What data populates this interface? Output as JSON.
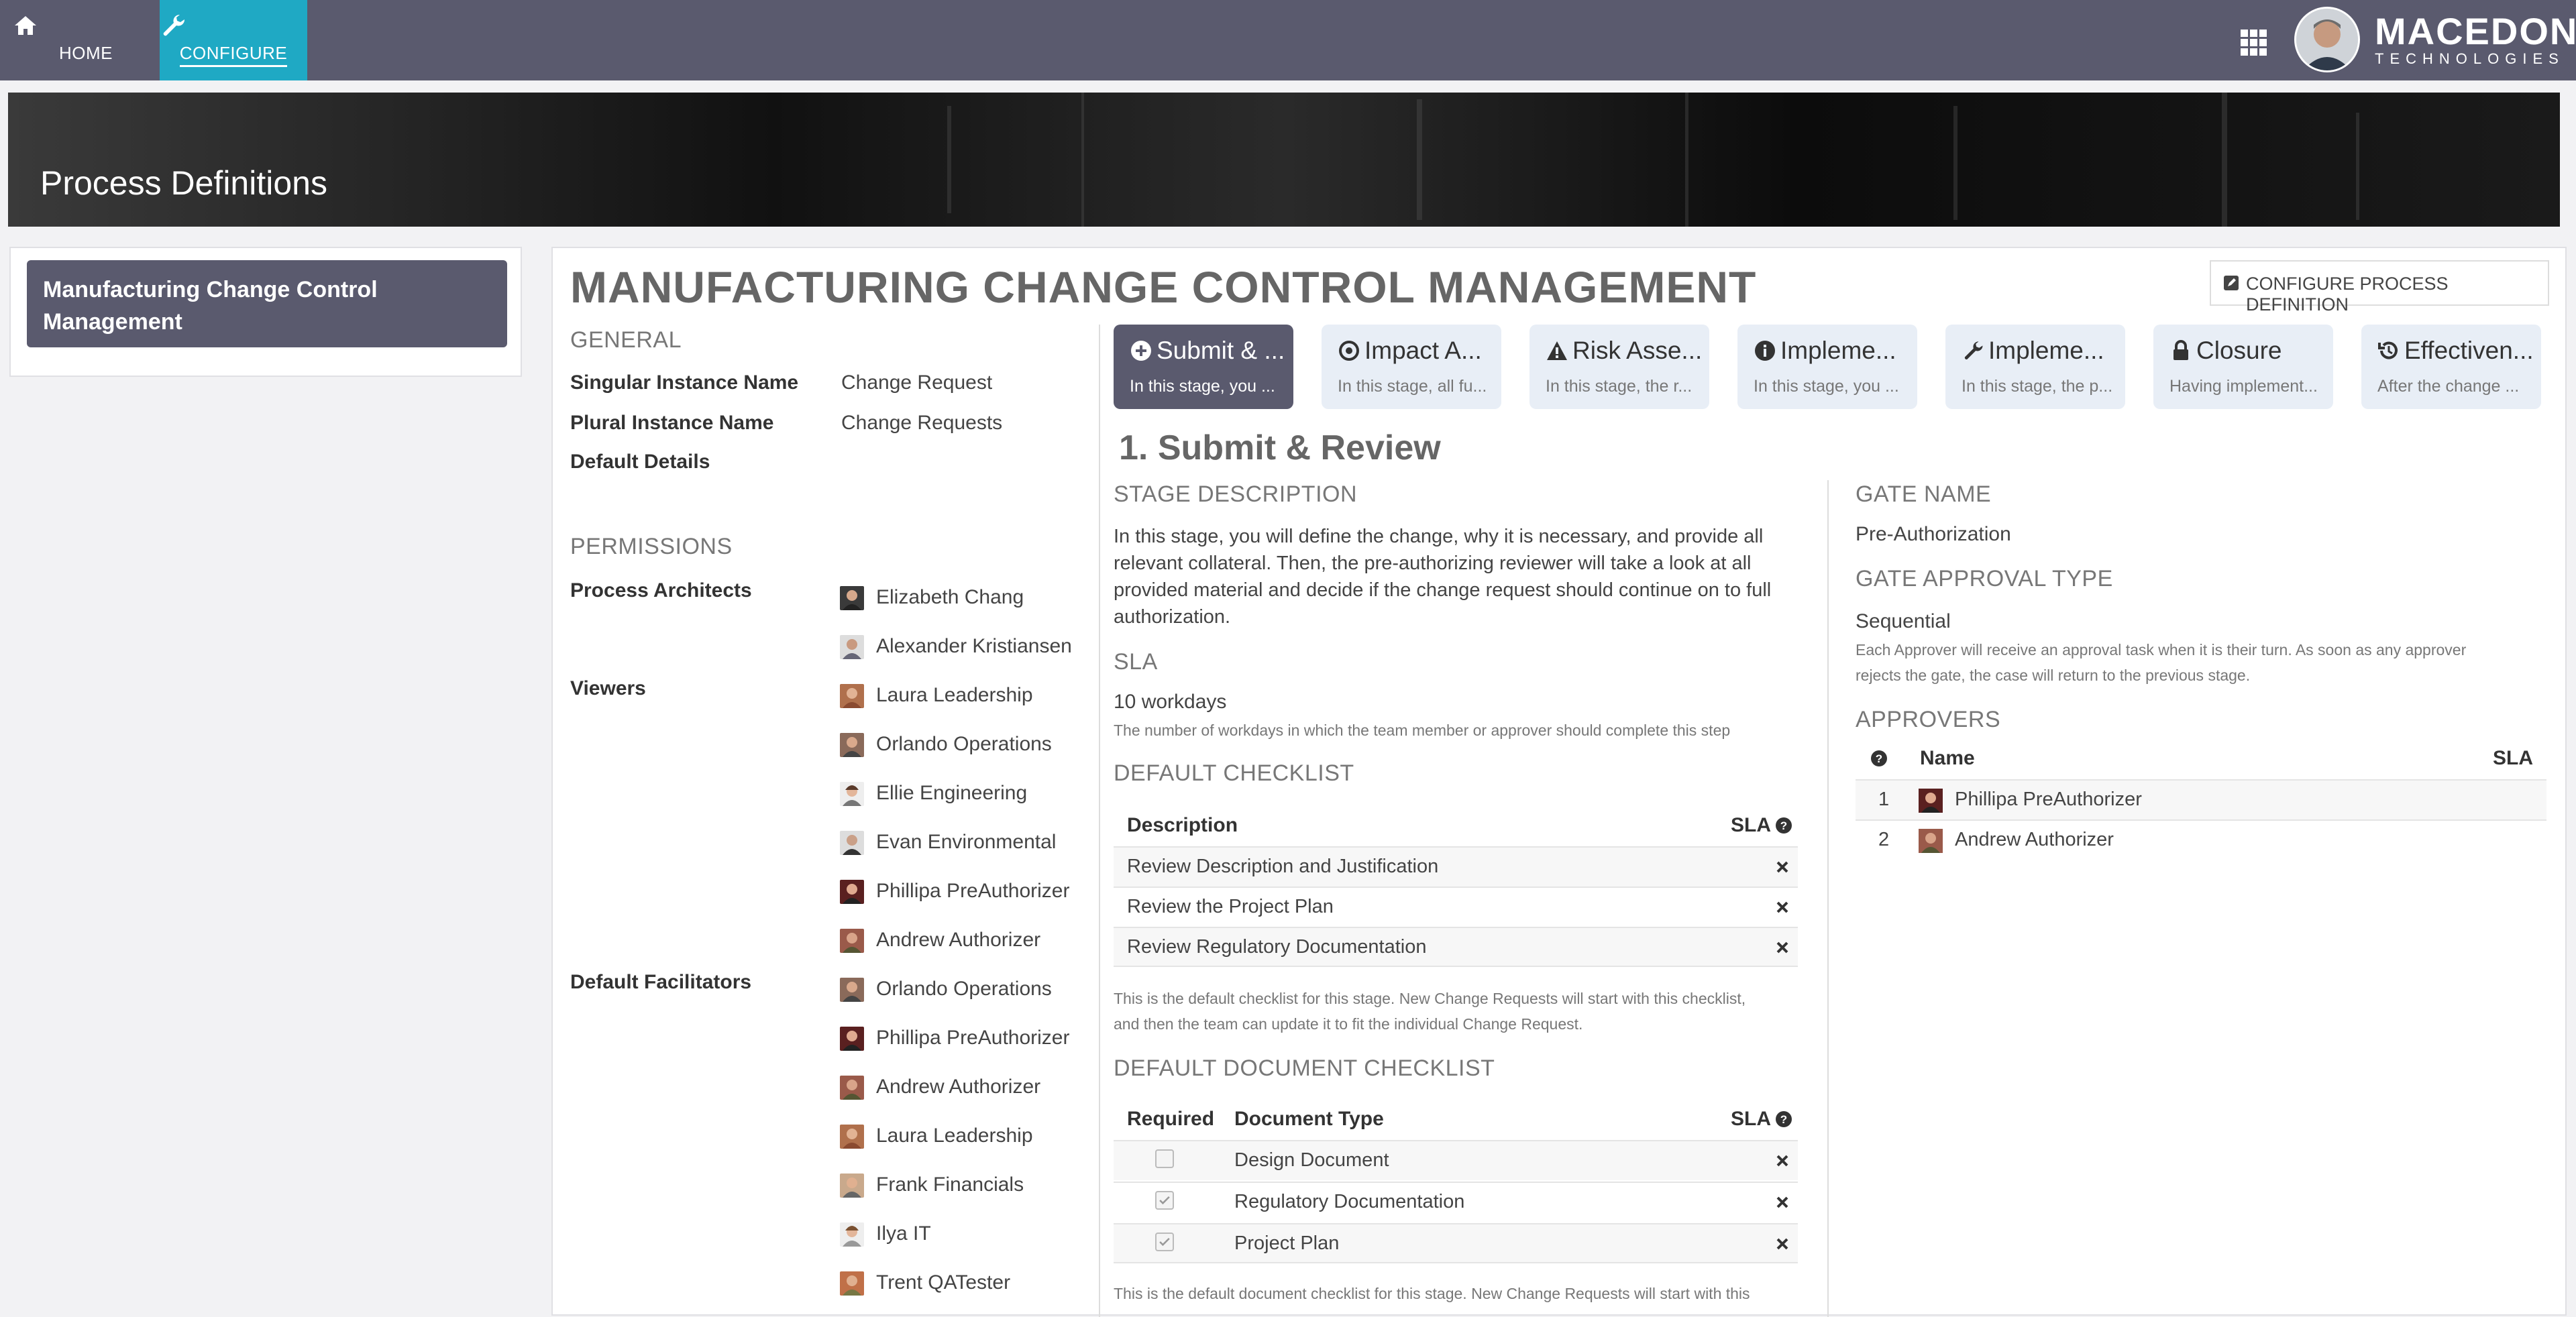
{
  "nav": {
    "home_label": "HOME",
    "configure_label": "CONFIGURE",
    "brand_name": "MACEDON",
    "brand_sub": "TECHNOLOGIES"
  },
  "banner": {
    "title": "Process Definitions"
  },
  "sidebar": {
    "items": [
      {
        "label": "Manufacturing Change Control Management"
      }
    ]
  },
  "main": {
    "title": "MANUFACTURING CHANGE CONTROL MANAGEMENT",
    "configure_button": "CONFIGURE PROCESS DEFINITION",
    "general": {
      "heading": "GENERAL",
      "singular_label": "Singular Instance Name",
      "singular_value": "Change Request",
      "plural_label": "Plural Instance Name",
      "plural_value": "Change Requests",
      "default_details_label": "Default Details"
    },
    "permissions": {
      "heading": "PERMISSIONS",
      "architects_label": "Process Architects",
      "viewers_label": "Viewers",
      "facilitators_label": "Default Facilitators",
      "architects": [
        "Elizabeth Chang",
        "Alexander Kristiansen"
      ],
      "viewers": [
        "Laura Leadership",
        "Orlando Operations",
        "Ellie Engineering",
        "Evan Environmental",
        "Phillipa PreAuthorizer",
        "Andrew Authorizer"
      ],
      "facilitators": [
        "Orlando Operations",
        "Phillipa PreAuthorizer",
        "Andrew Authorizer",
        "Laura Leadership",
        "Frank Financials",
        "Ilya IT",
        "Trent QATester"
      ]
    },
    "tabs": [
      {
        "label": "Submit & ...",
        "sub": "In this stage, you ...",
        "icon": "plus-circle-icon"
      },
      {
        "label": "Impact A...",
        "sub": "In this stage, all fu...",
        "icon": "dot-circle-icon"
      },
      {
        "label": "Risk Asse...",
        "sub": "In this stage, the r...",
        "icon": "warning-icon"
      },
      {
        "label": "Impleme...",
        "sub": "In this stage, you ...",
        "icon": "info-circle-icon"
      },
      {
        "label": "Impleme...",
        "sub": "In this stage, the p...",
        "icon": "wrench-icon"
      },
      {
        "label": "Closure",
        "sub": "Having implement...",
        "icon": "lock-icon"
      },
      {
        "label": "Effectiven...",
        "sub": "After the change ...",
        "icon": "history-icon"
      }
    ],
    "stage": {
      "title": "1. Submit & Review",
      "desc_heading": "STAGE DESCRIPTION",
      "desc": "In this stage, you will define the change, why it is necessary, and provide all relevant collateral. Then, the pre-authorizing reviewer will take a look at all provided material and decide if the change request should continue on to full authorization.",
      "sla_heading": "SLA",
      "sla_value": "10 workdays",
      "sla_note": "The number of workdays in which the team member or approver should complete this step",
      "checklist_heading": "DEFAULT CHECKLIST",
      "checklist_col_desc": "Description",
      "checklist_col_sla": "SLA",
      "checklist": [
        "Review Description and Justification",
        "Review the Project Plan",
        "Review Regulatory Documentation"
      ],
      "checklist_note_1": "This is the default checklist for this stage. New Change Requests will start with this checklist,",
      "checklist_note_2": "and then the team can update it to fit the individual Change Request.",
      "doc_heading": "DEFAULT DOCUMENT CHECKLIST",
      "doc_col_required": "Required",
      "doc_col_type": "Document Type",
      "doc_col_sla": "SLA",
      "docs": [
        {
          "type": "Design Document",
          "required": false
        },
        {
          "type": "Regulatory Documentation",
          "required": true
        },
        {
          "type": "Project Plan",
          "required": true
        }
      ],
      "doc_note": "This is the default document checklist for this stage. New Change Requests will start with this"
    },
    "gate": {
      "name_heading": "GATE NAME",
      "name_value": "Pre-Authorization",
      "approval_heading": "GATE APPROVAL TYPE",
      "approval_value": "Sequential",
      "approval_note_1": "Each Approver will receive an approval task when it is their turn. As soon as any approver",
      "approval_note_2": "rejects the gate, the case will return to the previous stage.",
      "approvers_heading": "APPROVERS",
      "col_name": "Name",
      "col_sla": "SLA",
      "approvers": [
        {
          "num": "1",
          "name": "Phillipa PreAuthorizer"
        },
        {
          "num": "2",
          "name": "Andrew Authorizer"
        }
      ]
    }
  },
  "colors": {
    "nav_bg": "#5a5a6e",
    "accent": "#1fa9c4",
    "tab_bg": "#e8eef6"
  }
}
